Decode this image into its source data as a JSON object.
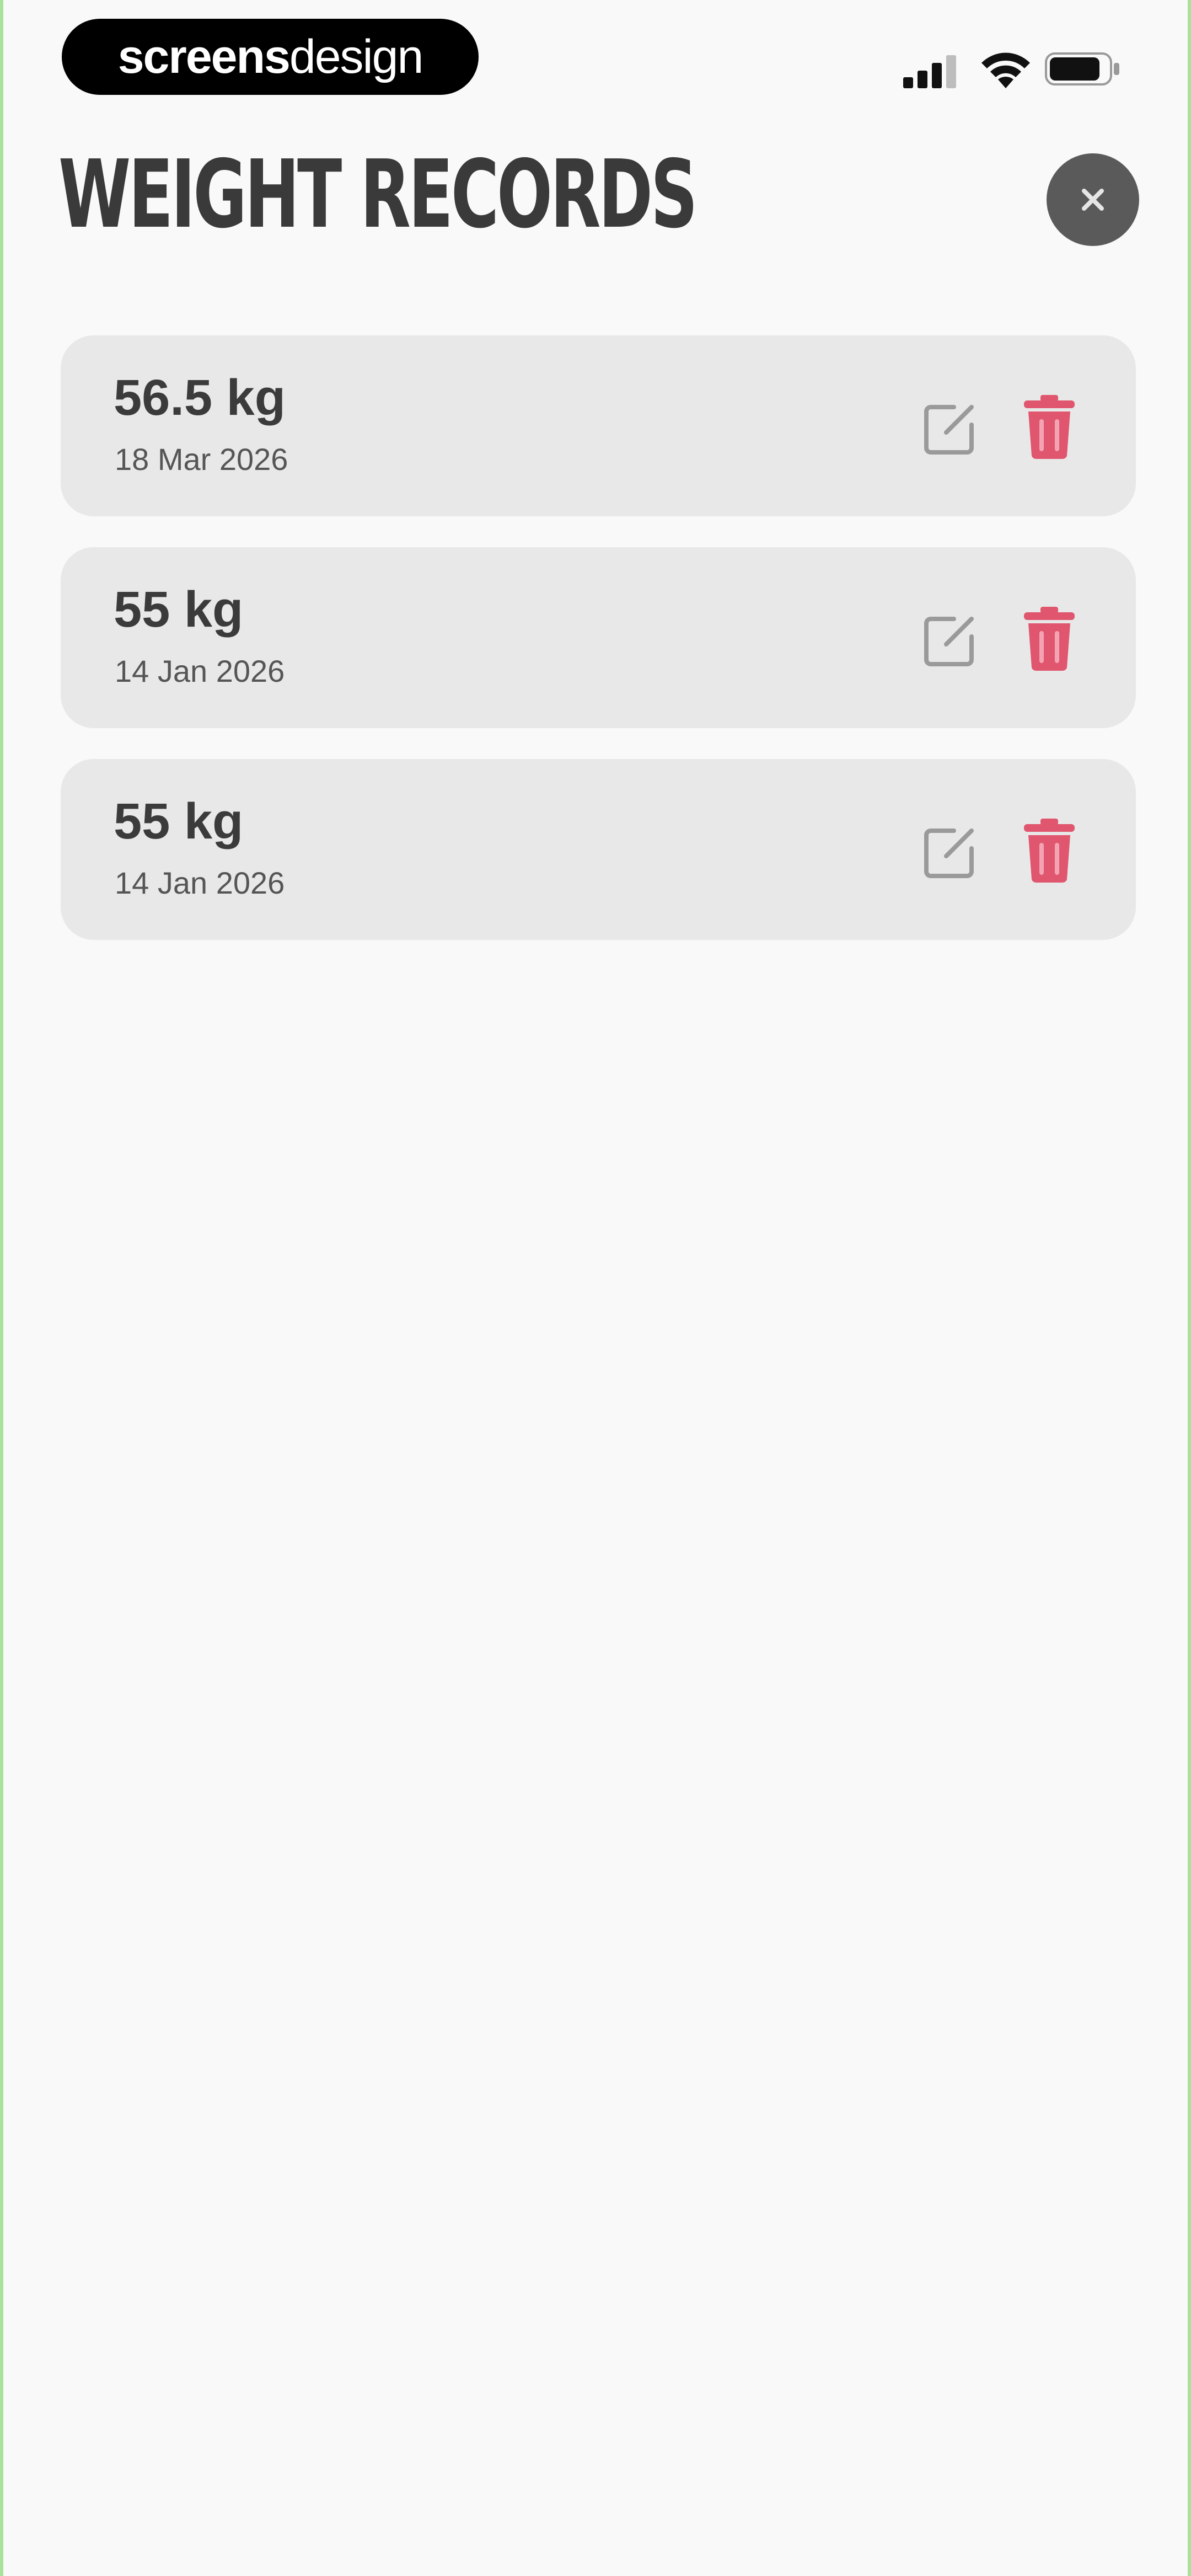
{
  "status_bar": {
    "brand_bold": "screens",
    "brand_light": "design",
    "icons": [
      "cellular-signal-icon",
      "wifi-icon",
      "battery-icon"
    ]
  },
  "header": {
    "title": "WEIGHT RECORDS",
    "close_icon": "close-icon"
  },
  "records": [
    {
      "weight": "56.5 kg",
      "date": "18 Mar 2026"
    },
    {
      "weight": "55 kg",
      "date": "14 Jan 2026"
    },
    {
      "weight": "55 kg",
      "date": "14 Jan 2026"
    }
  ],
  "colors": {
    "background": "#f9f9f9",
    "card": "#e8e8e8",
    "title": "#3a3a3a",
    "close_button": "#5a5a5a",
    "delete_icon": "#e0566e",
    "edit_icon": "#9a9a9a"
  }
}
